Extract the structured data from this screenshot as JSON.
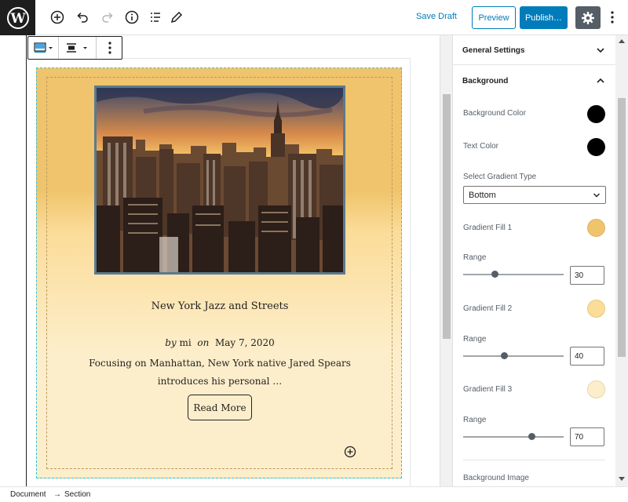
{
  "toolbar": {
    "save_draft": "Save Draft",
    "preview": "Preview",
    "publish": "Publish…"
  },
  "post": {
    "title": "New York Jazz and Streets",
    "byline_by": "by",
    "author": "mi",
    "byline_on": "on",
    "date": "May 7, 2020",
    "excerpt": "Focusing on Manhattan, New York native Jared Spears introduces his personal …",
    "read_more": "Read More"
  },
  "sidebar": {
    "general_settings": "General Settings",
    "background": "Background",
    "background_color_label": "Background Color",
    "text_color_label": "Text Color",
    "gradient_type_label": "Select Gradient Type",
    "gradient_type_value": "Bottom",
    "fill1_label": "Gradient Fill 1",
    "fill2_label": "Gradient Fill 2",
    "fill3_label": "Gradient Fill 3",
    "range_label": "Range",
    "range1": "30",
    "range2": "40",
    "range3": "70",
    "background_image": "Background Image"
  },
  "colors": {
    "background_color": "#000000",
    "text_color": "#000000",
    "fill1": "#f0c46c",
    "fill2": "#fbdc99",
    "fill3": "#fdeecb",
    "accent": "#007cba"
  },
  "breadcrumb": {
    "document": "Document",
    "arrow": "→",
    "section": "Section"
  }
}
